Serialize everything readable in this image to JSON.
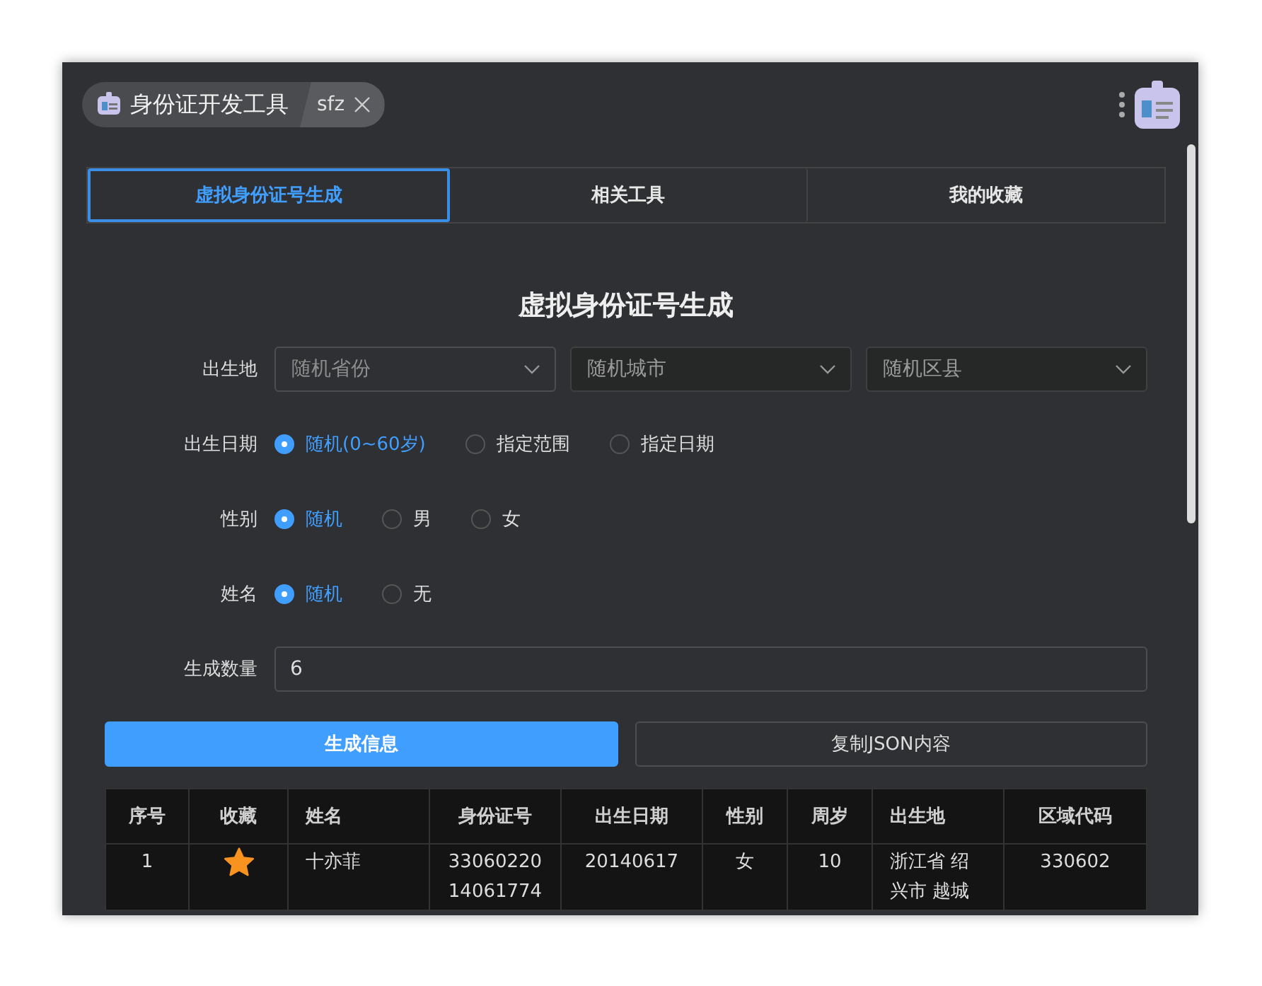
{
  "header": {
    "title": "身份证开发工具",
    "keyword": "sfz"
  },
  "tabs": [
    {
      "label": "虚拟身份证号生成",
      "selected": true
    },
    {
      "label": "相关工具",
      "selected": false
    },
    {
      "label": "我的收藏",
      "selected": false
    }
  ],
  "heading": "虚拟身份证号生成",
  "form": {
    "birthplace": {
      "label": "出生地",
      "selects": [
        {
          "placeholder": "随机省份",
          "disabled": false
        },
        {
          "placeholder": "随机城市",
          "disabled": true
        },
        {
          "placeholder": "随机区县",
          "disabled": true
        }
      ]
    },
    "radio_groups": [
      {
        "label": "出生日期",
        "options": [
          {
            "label": "随机(0~60岁)",
            "selected": true
          },
          {
            "label": "指定范围",
            "selected": false
          },
          {
            "label": "指定日期",
            "selected": false
          }
        ]
      },
      {
        "label": "性别",
        "options": [
          {
            "label": "随机",
            "selected": true
          },
          {
            "label": "男",
            "selected": false
          },
          {
            "label": "女",
            "selected": false
          }
        ]
      },
      {
        "label": "姓名",
        "options": [
          {
            "label": "随机",
            "selected": true
          },
          {
            "label": "无",
            "selected": false
          }
        ]
      }
    ],
    "count": {
      "label": "生成数量",
      "value": "6"
    }
  },
  "buttons": [
    {
      "label": "生成信息",
      "kind": "primary"
    },
    {
      "label": "复制JSON内容",
      "kind": "default"
    }
  ],
  "table": {
    "columns": [
      "序号",
      "收藏",
      "姓名",
      "身份证号",
      "出生日期",
      "性别",
      "周岁",
      "出生地",
      "区域代码"
    ],
    "rows": [
      {
        "index": "1",
        "favorite": true,
        "name": "十亦菲",
        "id_lines": [
          "33060220",
          "14061774"
        ],
        "birth_date": "20140617",
        "gender": "女",
        "age": "10",
        "birthplace_lines": [
          "浙江省 绍",
          "兴市 越城"
        ],
        "area_code": "330602"
      }
    ]
  }
}
